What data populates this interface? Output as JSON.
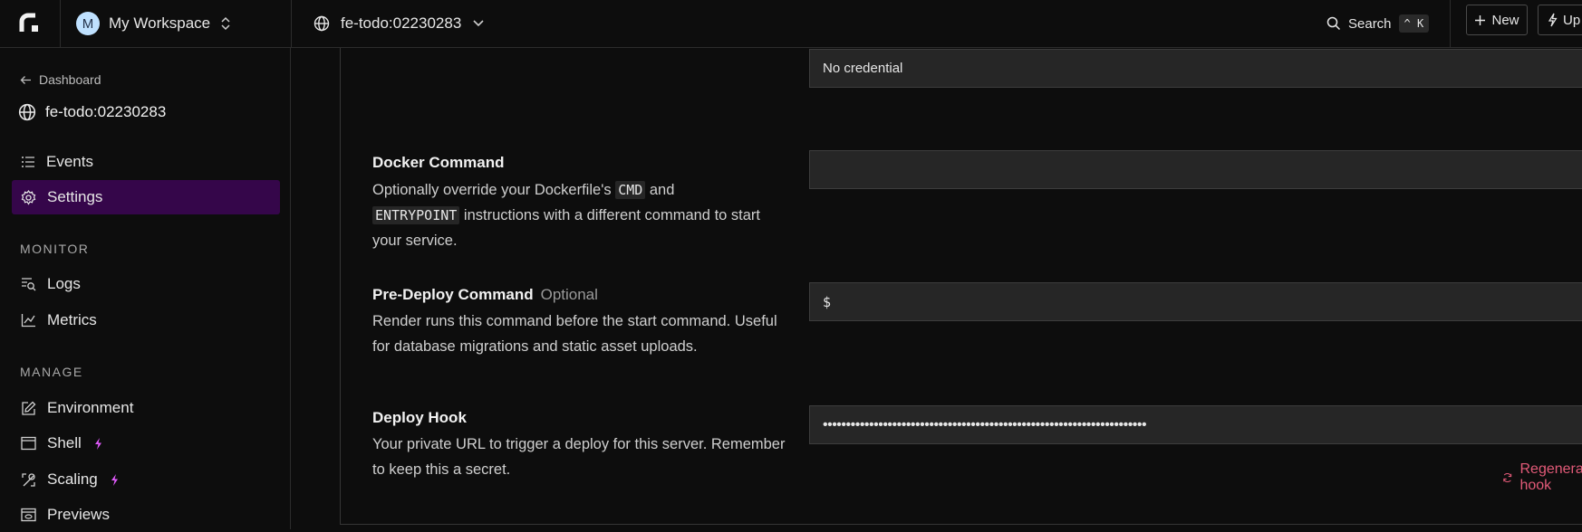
{
  "topbar": {
    "workspace_initial": "M",
    "workspace_name": "My Workspace",
    "service_name": "fe-todo:02230283",
    "search_label": "Search",
    "search_shortcut": "^ K",
    "new_label": "New",
    "upgrade_label": "Up"
  },
  "sidebar": {
    "back_label": "Dashboard",
    "service_title": "fe-todo:02230283",
    "items_top": [
      {
        "label": "Events",
        "icon": "list-icon"
      },
      {
        "label": "Settings",
        "icon": "gear-icon",
        "active": true
      }
    ],
    "monitor_heading": "MONITOR",
    "monitor_items": [
      {
        "label": "Logs",
        "icon": "logs-icon"
      },
      {
        "label": "Metrics",
        "icon": "chart-icon"
      }
    ],
    "manage_heading": "MANAGE",
    "manage_items": [
      {
        "label": "Environment",
        "icon": "edit-icon"
      },
      {
        "label": "Shell",
        "icon": "terminal-icon",
        "bolt": true
      },
      {
        "label": "Scaling",
        "icon": "scale-icon",
        "bolt": true
      },
      {
        "label": "Previews",
        "icon": "eye-icon"
      }
    ]
  },
  "main": {
    "registry_credential_value": "No credential",
    "docker_command": {
      "title": "Docker Command",
      "desc_pre": "Optionally override your Dockerfile's",
      "code1": "CMD",
      "desc_mid": "and",
      "code2": "ENTRYPOINT",
      "desc_post": "instructions with a different command to start your service.",
      "value": ""
    },
    "pre_deploy": {
      "title": "Pre-Deploy Command",
      "optional": "Optional",
      "desc": "Render runs this command before the start command. Useful for database migrations and static asset uploads.",
      "prefix": "$"
    },
    "deploy_hook": {
      "title": "Deploy Hook",
      "desc": "Your private URL to trigger a deploy for this server. Remember to keep this a secret.",
      "masked_value": "••••••••••••••••••••••••••••••••••••••••••••••••••••••••••••••••••••••",
      "regenerate_label": "Regenerate hook"
    }
  },
  "colors": {
    "accent_active": "#35064a",
    "bolt": "#e35bff",
    "regenerate": "#e25a78",
    "background": "#0d0d0d"
  }
}
